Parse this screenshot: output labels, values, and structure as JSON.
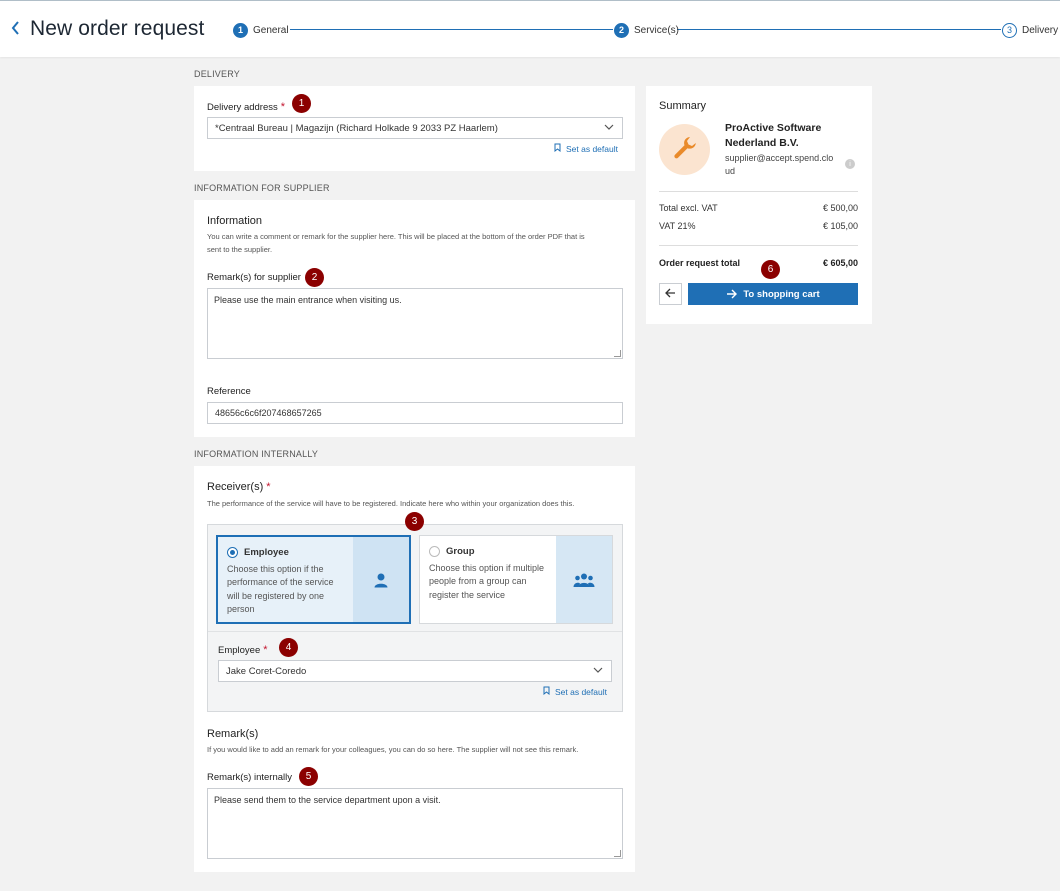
{
  "header": {
    "back_icon": "chevron-left-icon",
    "title": "New order request",
    "steps": [
      {
        "number": "1",
        "label": "General"
      },
      {
        "number": "2",
        "label": "Service(s)"
      },
      {
        "number": "3",
        "label": "Delivery"
      }
    ]
  },
  "delivery": {
    "section_label": "DELIVERY",
    "address_label": "Delivery address",
    "required_mark": "*",
    "badge": "1",
    "address_value": "*Centraal Bureau | Magazijn (Richard Holkade 9 2033 PZ Haarlem)",
    "set_default": "Set as default"
  },
  "supplier_info": {
    "section_label": "INFORMATION FOR SUPPLIER",
    "heading": "Information",
    "help_line1": "You can write a comment or remark for the supplier here. This will be placed at the bottom of the order PDF that is",
    "help_line2": "sent to the supplier.",
    "remarks_label": "Remark(s) for supplier",
    "badge": "2",
    "remarks_value": "Please use the main entrance when visiting us.",
    "reference_label": "Reference",
    "reference_value": "48656c6c6f207468657265"
  },
  "internal_info": {
    "section_label": "INFORMATION INTERNALLY",
    "receivers_heading": "Receiver(s)",
    "required_mark": "*",
    "receivers_help": "The performance of the service will have to be registered. Indicate here who within your organization does this.",
    "badge3": "3",
    "options": [
      {
        "title": "Employee",
        "desc": "Choose this option if the performance of the service will be registered by one person",
        "icon": "person-icon",
        "selected": true
      },
      {
        "title": "Group",
        "desc": "Choose this option if multiple people from a group can register the service",
        "icon": "group-icon",
        "selected": false
      }
    ],
    "employee_label": "Employee",
    "badge4": "4",
    "employee_value": "Jake Coret-Coredo",
    "set_default": "Set as default",
    "remarks_heading": "Remark(s)",
    "remarks_help": "If you would like to add an remark for your colleagues, you can do so here. The supplier will not see this remark.",
    "remarks_internal_label": "Remark(s) internally",
    "badge5": "5",
    "remarks_internal_value": "Please send them to the service department upon a visit."
  },
  "summary": {
    "title": "Summary",
    "supplier_icon": "wrench-icon",
    "supplier_name_line1": "ProActive Software",
    "supplier_name_line2": "Nederland B.V.",
    "supplier_email_line1": "supplier@accept.spend.clo",
    "supplier_email_line2": "ud",
    "rows": [
      {
        "label": "Total excl. VAT",
        "value": "€ 500,00"
      },
      {
        "label": "VAT 21%",
        "value": "€ 105,00"
      }
    ],
    "total_label": "Order request total",
    "total_value": "€ 605,00",
    "badge": "6",
    "cart_button": "To shopping cart"
  },
  "colors": {
    "accent": "#1f6fb5",
    "badge": "#8b0000",
    "required": "#c3152e"
  }
}
